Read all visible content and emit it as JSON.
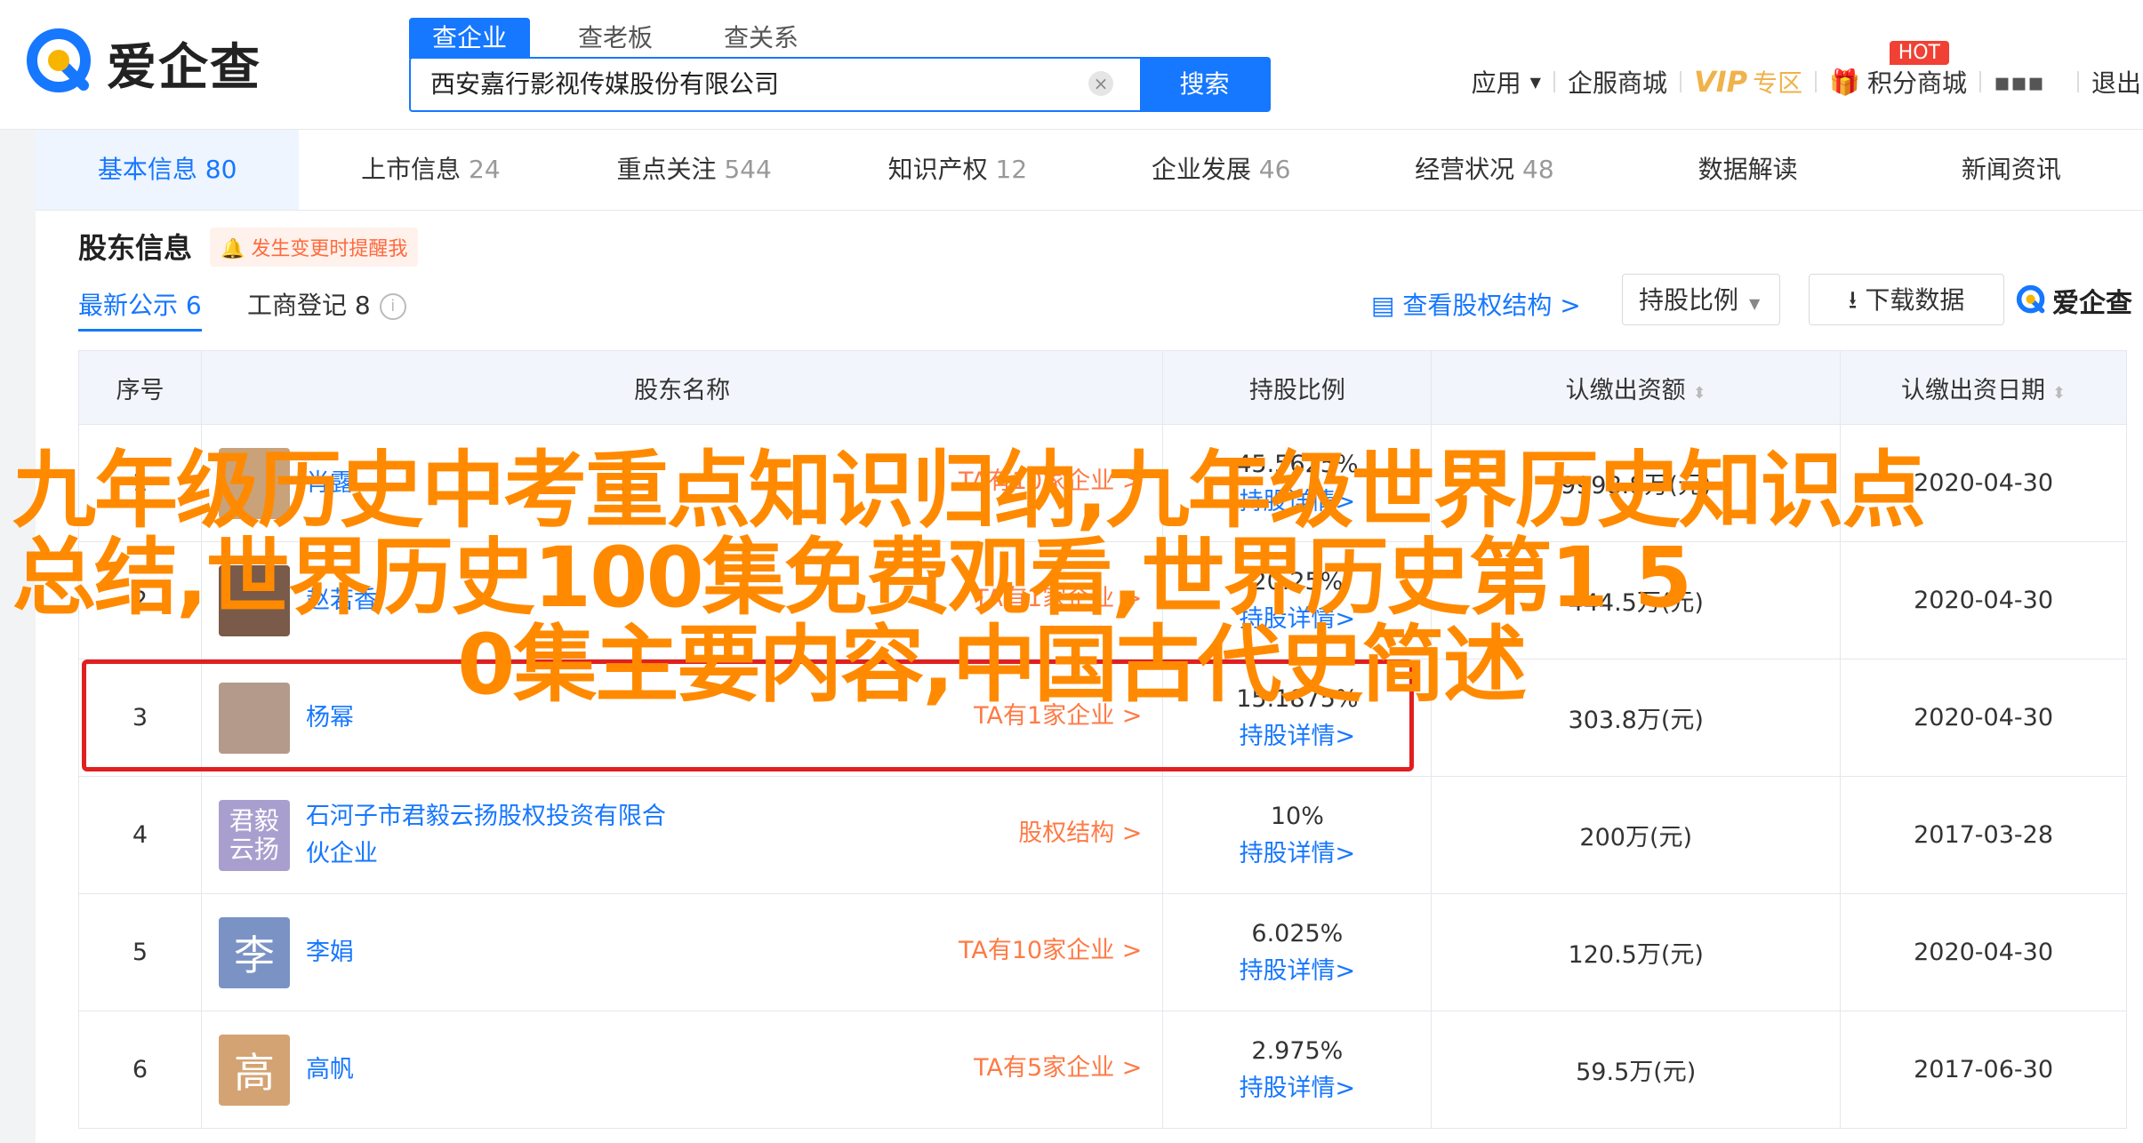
{
  "logo": {
    "text": "爱企查"
  },
  "search": {
    "tabs": [
      "查企业",
      "查老板",
      "查关系"
    ],
    "value": "西安嘉行影视传媒股份有限公司",
    "button": "搜索"
  },
  "topnav": {
    "app": "应用",
    "service": "企服商城",
    "vip": "VIP",
    "vip_zone": "专区",
    "points": "积分商城",
    "hot": "HOT",
    "extra": "退出"
  },
  "subnav": [
    {
      "label": "基本信息",
      "count": "80"
    },
    {
      "label": "上市信息",
      "count": "24"
    },
    {
      "label": "重点关注",
      "count": "544"
    },
    {
      "label": "知识产权",
      "count": "12"
    },
    {
      "label": "企业发展",
      "count": "46"
    },
    {
      "label": "经营状况",
      "count": "48"
    },
    {
      "label": "数据解读",
      "count": ""
    },
    {
      "label": "新闻资讯",
      "count": ""
    }
  ],
  "section": {
    "title": "股东信息",
    "remind": "发生变更时提醒我",
    "tab_latest": "最新公示 6",
    "tab_registry": "工商登记 8",
    "view_structure": "查看股权结构 >",
    "ratio_select": "持股比例",
    "download": "下载数据",
    "brand": "爱企查"
  },
  "table": {
    "headers": [
      "序号",
      "股东名称",
      "持股比例",
      "认缴出资额",
      "认缴出资日期"
    ],
    "rows": [
      {
        "no": "1",
        "avatar": "",
        "avatar_color": "#c9a27a",
        "name": "肖露",
        "tag": "TA有10家企业 >",
        "pct": "45.5625%",
        "detail": "持股详情>",
        "amount": "9998.8万(元)",
        "date": "2020-04-30"
      },
      {
        "no": "2",
        "avatar": "",
        "avatar_color": "#7a5a48",
        "name": "赵若香",
        "tag": "TA有1家企业 >",
        "pct": "20.25%",
        "detail": "持股详情>",
        "amount": "444.5万(元)",
        "date": "2020-04-30"
      },
      {
        "no": "3",
        "avatar": "",
        "avatar_color": "#b49a8a",
        "name": "杨幂",
        "tag": "TA有1家企业 >",
        "pct": "15.1875%",
        "detail": "持股详情>",
        "amount": "303.8万(元)",
        "date": "2020-04-30"
      },
      {
        "no": "4",
        "avatar": "君毅\n云扬",
        "avatar_color": "#a99fcf",
        "name": "石河子市君毅云扬股权投资有限合伙企业",
        "tag": "股权结构 >",
        "pct": "10%",
        "detail": "持股详情>",
        "amount": "200万(元)",
        "date": "2017-03-28"
      },
      {
        "no": "5",
        "avatar": "李",
        "avatar_color": "#7b93c4",
        "name": "李娟",
        "tag": "TA有10家企业 >",
        "pct": "6.025%",
        "detail": "持股详情>",
        "amount": "120.5万(元)",
        "date": "2020-04-30"
      },
      {
        "no": "6",
        "avatar": "高",
        "avatar_color": "#d4a373",
        "name": "高帆",
        "tag": "TA有5家企业 >",
        "pct": "2.975%",
        "detail": "持股详情>",
        "amount": "59.5万(元)",
        "date": "2017-06-30"
      }
    ]
  },
  "overlay": {
    "line1": "九年级历史中考重点知识归纳,九年级世界历史知识点",
    "line2": "总结,世界历史100集免费观看,世界历史第1 5",
    "line3": "0集主要内容,中国古代史简述"
  }
}
